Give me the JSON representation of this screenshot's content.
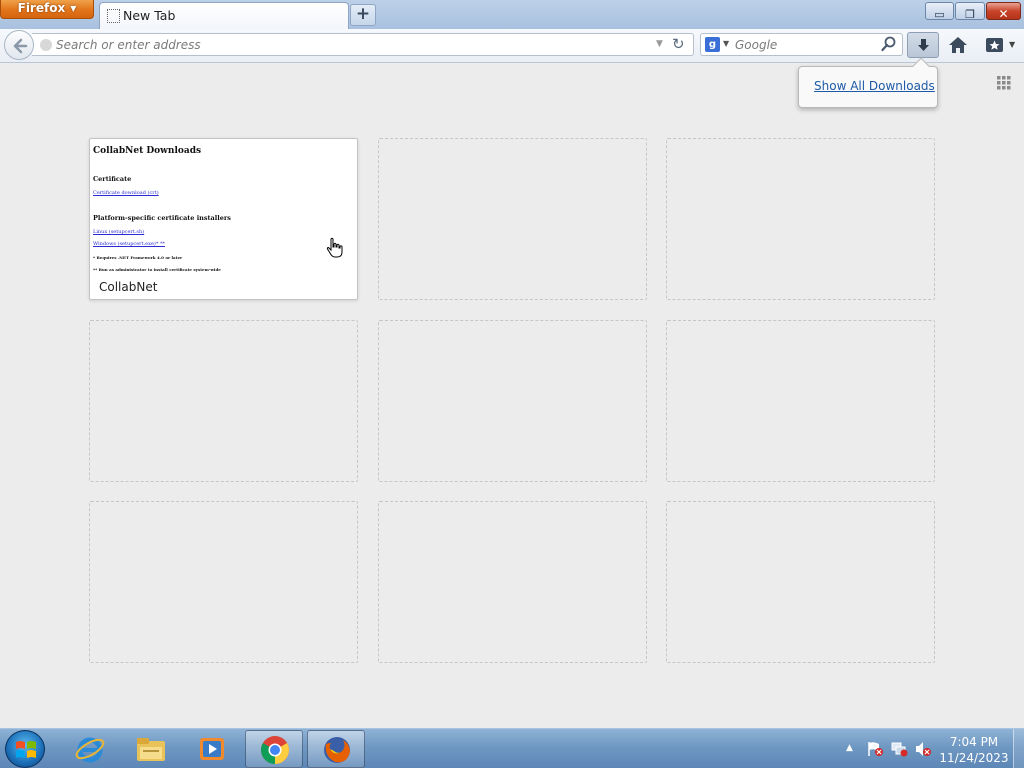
{
  "browser": {
    "app_button": "Firefox",
    "tab": {
      "title": "New Tab"
    },
    "new_tab_symbol": "+",
    "window_controls": {
      "minimize": "▭",
      "maximize": "❐",
      "close": "✕"
    }
  },
  "navbar": {
    "address_placeholder": "Search or enter address",
    "search_engine_icon": "g",
    "search_placeholder": "Google"
  },
  "downloads_panel": {
    "show_all_label": "Show All Downloads"
  },
  "tiles": [
    {
      "label": "CollabNet",
      "thumbnail": {
        "title": "CollabNet Downloads",
        "heading_1": "Certificate",
        "link_1": "Certificate download (crt)",
        "heading_2": "Platform-specific certificate installers",
        "link_2": "Linux (setupcert.sh)",
        "link_3": "Windows (setupcert.exe)* **",
        "note_1": "* Requires .NET Framework 4.0 or later",
        "note_2": "** Run as administrator to install certificate system-wide"
      }
    },
    {
      "label": ""
    },
    {
      "label": ""
    },
    {
      "label": ""
    },
    {
      "label": ""
    },
    {
      "label": ""
    },
    {
      "label": ""
    },
    {
      "label": ""
    },
    {
      "label": ""
    }
  ],
  "taskbar": {
    "items": [
      {
        "icon": "internet-explorer-icon",
        "open": false
      },
      {
        "icon": "file-explorer-icon",
        "open": false
      },
      {
        "icon": "media-player-icon",
        "open": false
      },
      {
        "icon": "chrome-icon",
        "open": true
      },
      {
        "icon": "firefox-icon",
        "open": true
      }
    ],
    "clock": {
      "time": "7:04 PM",
      "date": "11/24/2023"
    }
  },
  "colors": {
    "firefox_orange": "#e2751b",
    "link_blue": "#1e5aa8",
    "page_background": "#ececec",
    "taskbar_blue": "#6f98c3"
  }
}
